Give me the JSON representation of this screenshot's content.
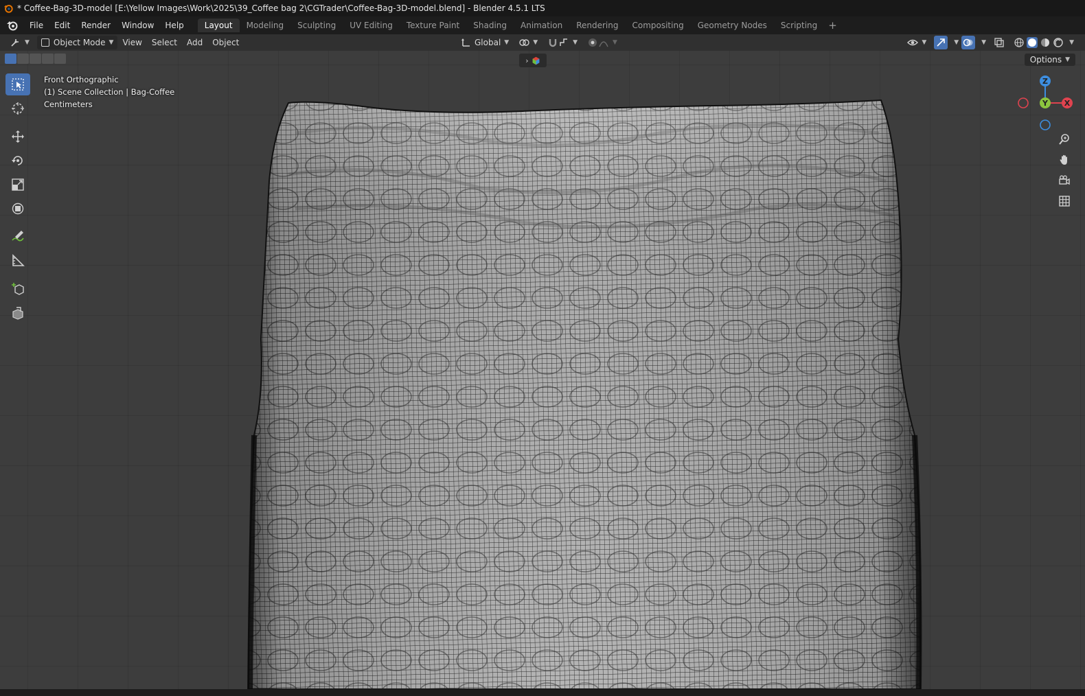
{
  "window": {
    "title": "* Coffee-Bag-3D-model [E:\\Yellow Images\\Work\\2025\\39_Coffee bag 2\\CGTrader\\Coffee-Bag-3D-model.blend] - Blender 4.5.1 LTS"
  },
  "menu": {
    "items": [
      "File",
      "Edit",
      "Render",
      "Window",
      "Help"
    ]
  },
  "workspaces": {
    "tabs": [
      "Layout",
      "Modeling",
      "Sculpting",
      "UV Editing",
      "Texture Paint",
      "Shading",
      "Animation",
      "Rendering",
      "Compositing",
      "Geometry Nodes",
      "Scripting"
    ],
    "active": "Layout",
    "add_label": "+"
  },
  "header": {
    "mode": "Object Mode",
    "menus": [
      "View",
      "Select",
      "Add",
      "Object"
    ],
    "transform_orientation": "Global"
  },
  "viewport": {
    "view_name": "Front Orthographic",
    "collection_line": "(1) Scene Collection | Bag-Coffee",
    "units": "Centimeters",
    "options_label": "Options"
  },
  "gizmo": {
    "x_label": "X",
    "y_label": "Y",
    "z_label": "Z",
    "x_color": "#e0434f",
    "y_color": "#8cc53f",
    "z_color": "#3d8ee0"
  },
  "tools": [
    "select-box",
    "cursor",
    "move",
    "rotate",
    "scale",
    "transform",
    "annotate",
    "measure",
    "add-cube",
    "extrude"
  ],
  "colors": {
    "accent": "#4772b3",
    "background": "#3d3d3d",
    "mesh_face": "#b4b4b4"
  }
}
